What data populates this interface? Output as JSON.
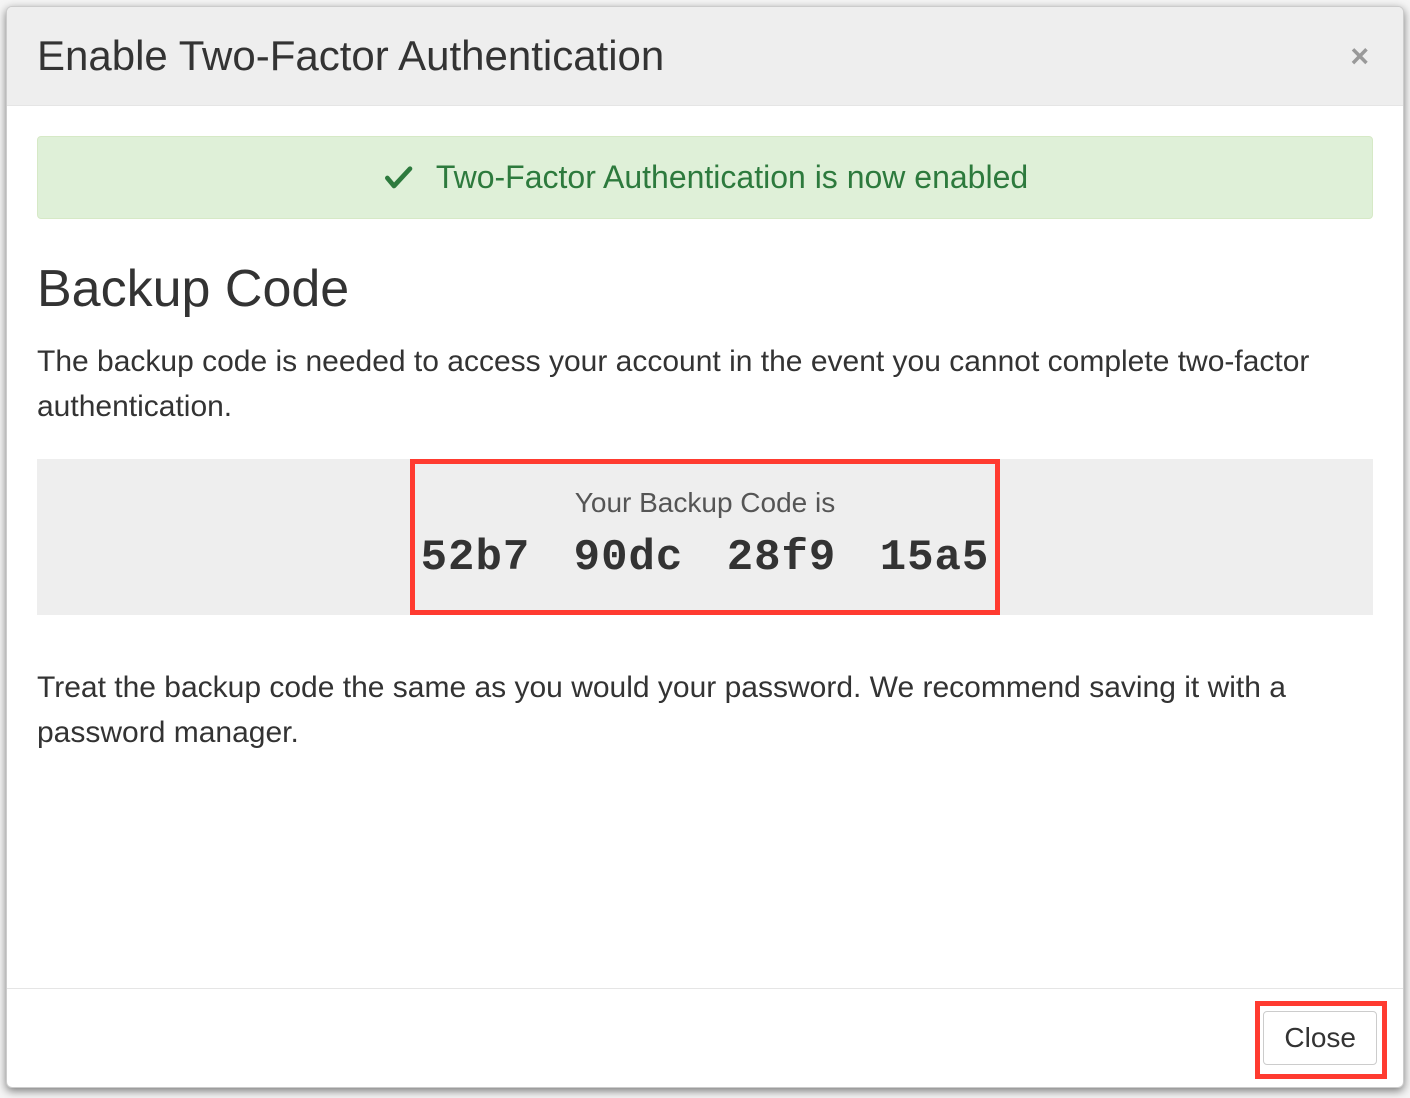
{
  "modal": {
    "title": "Enable Two-Factor Authentication",
    "alert": {
      "message": "Two-Factor Authentication is now enabled"
    },
    "heading": "Backup Code",
    "description": "The backup code is needed to access your account in the event you cannot complete two-factor authentication.",
    "backup_code": {
      "label": "Your Backup Code is",
      "value": "52b7 90dc 28f9 15a5"
    },
    "warning": "Treat the backup code the same as you would your password. We recommend saving it with a password manager.",
    "close_button_label": "Close"
  }
}
